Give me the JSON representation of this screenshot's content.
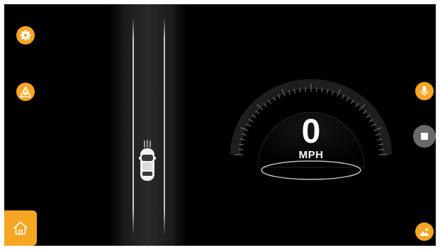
{
  "speedometer": {
    "speed": "0",
    "unit": "MPH"
  },
  "icons": {
    "settings": "gear-icon",
    "road_view": "road-camera-icon",
    "microphone": "microphone-icon",
    "stop": "stop-icon",
    "gallery": "image-icon",
    "home": "home-icon"
  },
  "colors": {
    "accent": "#f6a623",
    "background": "#000000",
    "stop_button": "#6a6a6a",
    "text": "#ffffff"
  }
}
